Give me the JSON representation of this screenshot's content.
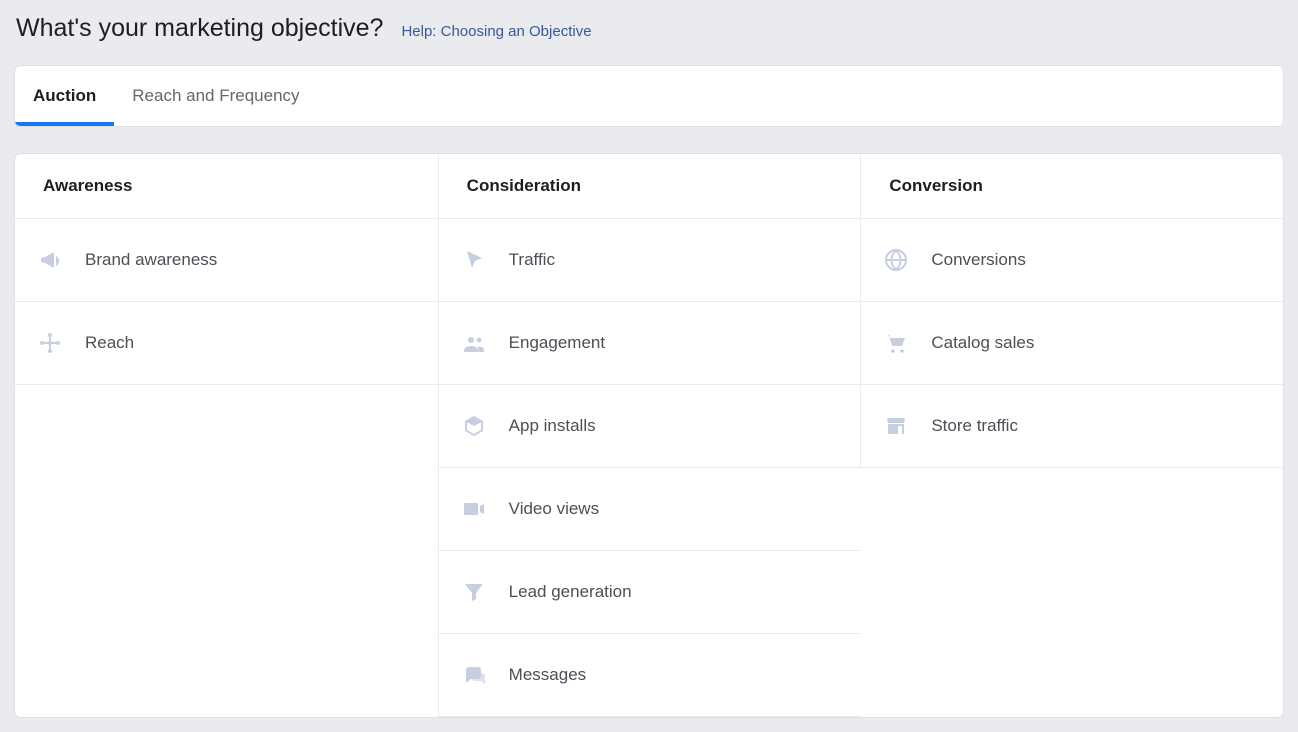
{
  "header": {
    "title": "What's your marketing objective?",
    "help_link": "Help: Choosing an Objective"
  },
  "tabs": [
    {
      "label": "Auction",
      "active": true
    },
    {
      "label": "Reach and Frequency",
      "active": false
    }
  ],
  "columns": [
    {
      "header": "Awareness",
      "items": [
        {
          "label": "Brand awareness",
          "icon": "megaphone-icon"
        },
        {
          "label": "Reach",
          "icon": "network-icon"
        }
      ]
    },
    {
      "header": "Consideration",
      "items": [
        {
          "label": "Traffic",
          "icon": "cursor-icon"
        },
        {
          "label": "Engagement",
          "icon": "people-icon"
        },
        {
          "label": "App installs",
          "icon": "cube-icon"
        },
        {
          "label": "Video views",
          "icon": "video-icon"
        },
        {
          "label": "Lead generation",
          "icon": "funnel-icon"
        },
        {
          "label": "Messages",
          "icon": "chat-icon"
        }
      ]
    },
    {
      "header": "Conversion",
      "items": [
        {
          "label": "Conversions",
          "icon": "globe-icon"
        },
        {
          "label": "Catalog sales",
          "icon": "cart-icon"
        },
        {
          "label": "Store traffic",
          "icon": "store-icon"
        }
      ]
    }
  ]
}
